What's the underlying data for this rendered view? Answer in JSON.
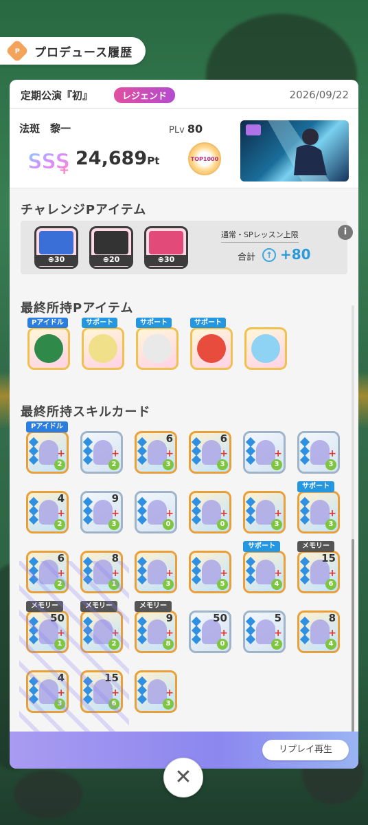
{
  "header": {
    "title": "プロデュース履歴",
    "icon": "produce-icon",
    "icon_text": "P"
  },
  "record": {
    "event_name": "定期公演『初』",
    "rank_badge": "レジェンド",
    "date": "2026/09/22",
    "player_name": "法斑　黎一",
    "plv_label": "PLv",
    "plv_value": "80",
    "score": "24,689",
    "score_unit": "Pt",
    "rank": "SSS+",
    "medal_text": "TOP1000"
  },
  "challenge": {
    "title": "チャレンジPアイテム",
    "items": [
      {
        "name": "challenge-item-1",
        "cost": "30",
        "color": "#3b6fd8"
      },
      {
        "name": "challenge-item-2",
        "cost": "20",
        "color": "#333333"
      },
      {
        "name": "challenge-item-3",
        "cost": "30",
        "color": "#e24a79"
      }
    ],
    "limit_label": "通常・SPレッスン上限",
    "total_label": "合計",
    "total_value": "+80"
  },
  "final_pitems": {
    "title": "最終所持Pアイテム",
    "items": [
      {
        "tag": "Pアイドル",
        "icon": "green-hat-icon",
        "color": "#2f8a4a"
      },
      {
        "tag": "サポート",
        "icon": "popcorn-icon",
        "color": "#f1e08a"
      },
      {
        "tag": "サポート",
        "icon": "desk-lamp-icon",
        "color": "#e9e9e9"
      },
      {
        "tag": "サポート",
        "icon": "noodle-pack-icon",
        "color": "#e74c3c"
      },
      {
        "tag": "",
        "icon": "bear-figure-icon",
        "color": "#8fd3f4"
      }
    ]
  },
  "skill_cards": {
    "title": "最終所持スキルカード",
    "cards": [
      {
        "tag": "Pアイドル",
        "num": "",
        "cost": "2",
        "gold": true
      },
      {
        "tag": "",
        "num": "",
        "cost": "2",
        "gold": false
      },
      {
        "tag": "",
        "num": "6",
        "cost": "3",
        "gold": true
      },
      {
        "tag": "",
        "num": "6",
        "cost": "3",
        "gold": true
      },
      {
        "tag": "",
        "num": "",
        "cost": "3",
        "gold": false
      },
      {
        "tag": "",
        "num": "",
        "cost": "3",
        "gold": false
      },
      {
        "tag": "",
        "num": "4",
        "cost": "2",
        "gold": true
      },
      {
        "tag": "",
        "num": "9",
        "cost": "3",
        "gold": false
      },
      {
        "tag": "",
        "num": "",
        "cost": "0",
        "gold": false
      },
      {
        "tag": "",
        "num": "",
        "cost": "0",
        "gold": true
      },
      {
        "tag": "",
        "num": "",
        "cost": "3",
        "gold": true
      },
      {
        "tag": "サポート",
        "num": "",
        "cost": "3",
        "gold": true
      },
      {
        "tag": "",
        "num": "6",
        "cost": "2",
        "gold": true
      },
      {
        "tag": "",
        "num": "8",
        "cost": "1",
        "gold": true
      },
      {
        "tag": "",
        "num": "",
        "cost": "3",
        "gold": true
      },
      {
        "tag": "",
        "num": "",
        "cost": "5",
        "gold": true
      },
      {
        "tag": "サポート",
        "num": "",
        "cost": "4",
        "gold": true
      },
      {
        "tag": "メモリー",
        "num": "15",
        "cost": "6",
        "gold": true
      },
      {
        "tag": "メモリー",
        "num": "50",
        "cost": "1",
        "gold": true
      },
      {
        "tag": "メモリー",
        "num": "",
        "cost": "2",
        "gold": true
      },
      {
        "tag": "メモリー",
        "num": "9",
        "cost": "8",
        "gold": true
      },
      {
        "tag": "",
        "num": "50",
        "cost": "0",
        "gold": false
      },
      {
        "tag": "",
        "num": "5",
        "cost": "2",
        "gold": false
      },
      {
        "tag": "",
        "num": "8",
        "cost": "4",
        "gold": true
      },
      {
        "tag": "",
        "num": "4",
        "cost": "3",
        "gold": true
      },
      {
        "tag": "",
        "num": "15",
        "cost": "6",
        "gold": true
      },
      {
        "tag": "",
        "num": "",
        "cost": "3",
        "gold": true
      }
    ]
  },
  "footer": {
    "replay_label": "リプレイ再生"
  },
  "close": {
    "label": "✕"
  }
}
